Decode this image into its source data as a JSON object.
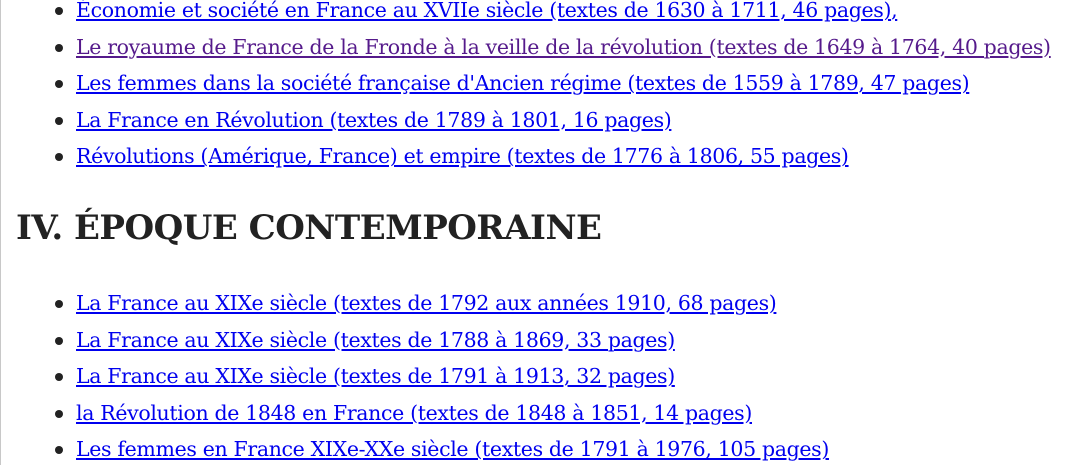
{
  "top_links": [
    {
      "label": "Économie et société en France au XVIIe siècle (textes de 1630 à 1711, 46 pages)",
      "trailing": ",",
      "visited": false
    },
    {
      "label": "Le royaume de France de la Fronde à la veille de la révolution (textes de 1649 à 1764, 40 pages)",
      "trailing": "",
      "visited": true
    },
    {
      "label": "Les femmes dans la société française d'Ancien régime (textes de 1559 à 1789, 47 pages)",
      "trailing": "",
      "visited": false
    },
    {
      "label": "La France en Révolution (textes de 1789 à 1801, 16 pages)",
      "trailing": "",
      "visited": false
    },
    {
      "label": "Révolutions (Amérique, France) et empire (textes de 1776 à 1806, 55 pages)",
      "trailing": "",
      "visited": false
    }
  ],
  "section_heading": "IV. ÉPOQUE CONTEMPORAINE",
  "bottom_links": [
    {
      "label": "La France au XIXe siècle (textes de 1792 aux années 1910, 68 pages)",
      "trailing": "",
      "visited": false
    },
    {
      "label": "La France au XIXe siècle (textes de 1788 à 1869, 33 pages)",
      "trailing": "",
      "visited": false
    },
    {
      "label": "La France au XIXe siècle (textes de 1791 à 1913, 32 pages)",
      "trailing": "",
      "visited": false
    },
    {
      "label": "la Révolution de 1848 en France (textes de 1848 à 1851, 14 pages)",
      "trailing": "",
      "visited": false
    },
    {
      "label": "Les femmes en France XIXe-XXe siècle (textes de 1791 à 1976, 105 pages)",
      "trailing": "",
      "visited": false
    }
  ],
  "colors": {
    "link": "#0000ee",
    "visited_link": "#551a8b",
    "text": "#222222",
    "background": "#ffffff"
  }
}
